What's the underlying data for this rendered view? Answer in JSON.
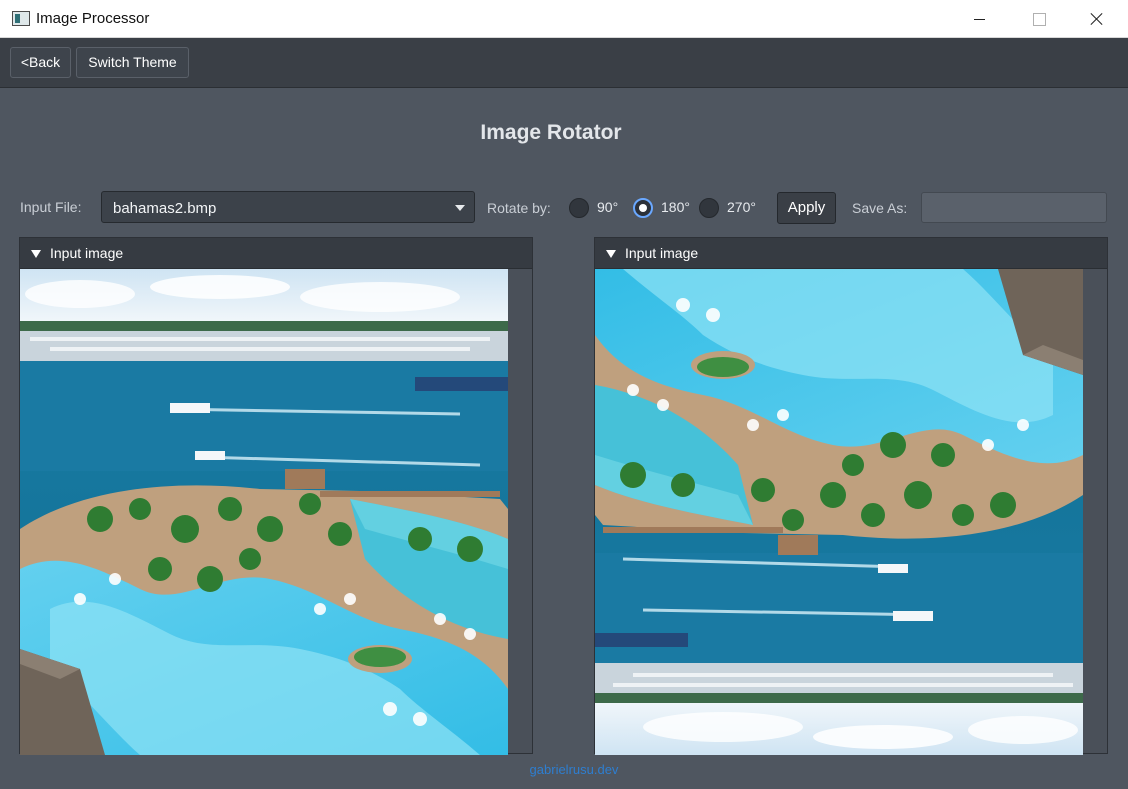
{
  "window": {
    "title": "Image Processor"
  },
  "toolbar": {
    "back_label": "<Back",
    "theme_label": "Switch Theme"
  },
  "page": {
    "title": "Image Rotator"
  },
  "controls": {
    "input_file_label": "Input File:",
    "input_file_value": "bahamas2.bmp",
    "rotate_label": "Rotate by:",
    "rotate_options": [
      "90°",
      "180°",
      "270°"
    ],
    "rotate_selected": "180°",
    "apply_label": "Apply",
    "save_as_label": "Save As:",
    "save_as_value": ""
  },
  "panels": {
    "left_title": "Input image",
    "right_title": "Input image"
  },
  "footer": {
    "link_text": "gabrielrusu.dev"
  },
  "colors": {
    "accent": "#6aa8ff",
    "background": "#4f5660",
    "toolbar": "#3a3f46",
    "link": "#2e7ed0"
  }
}
